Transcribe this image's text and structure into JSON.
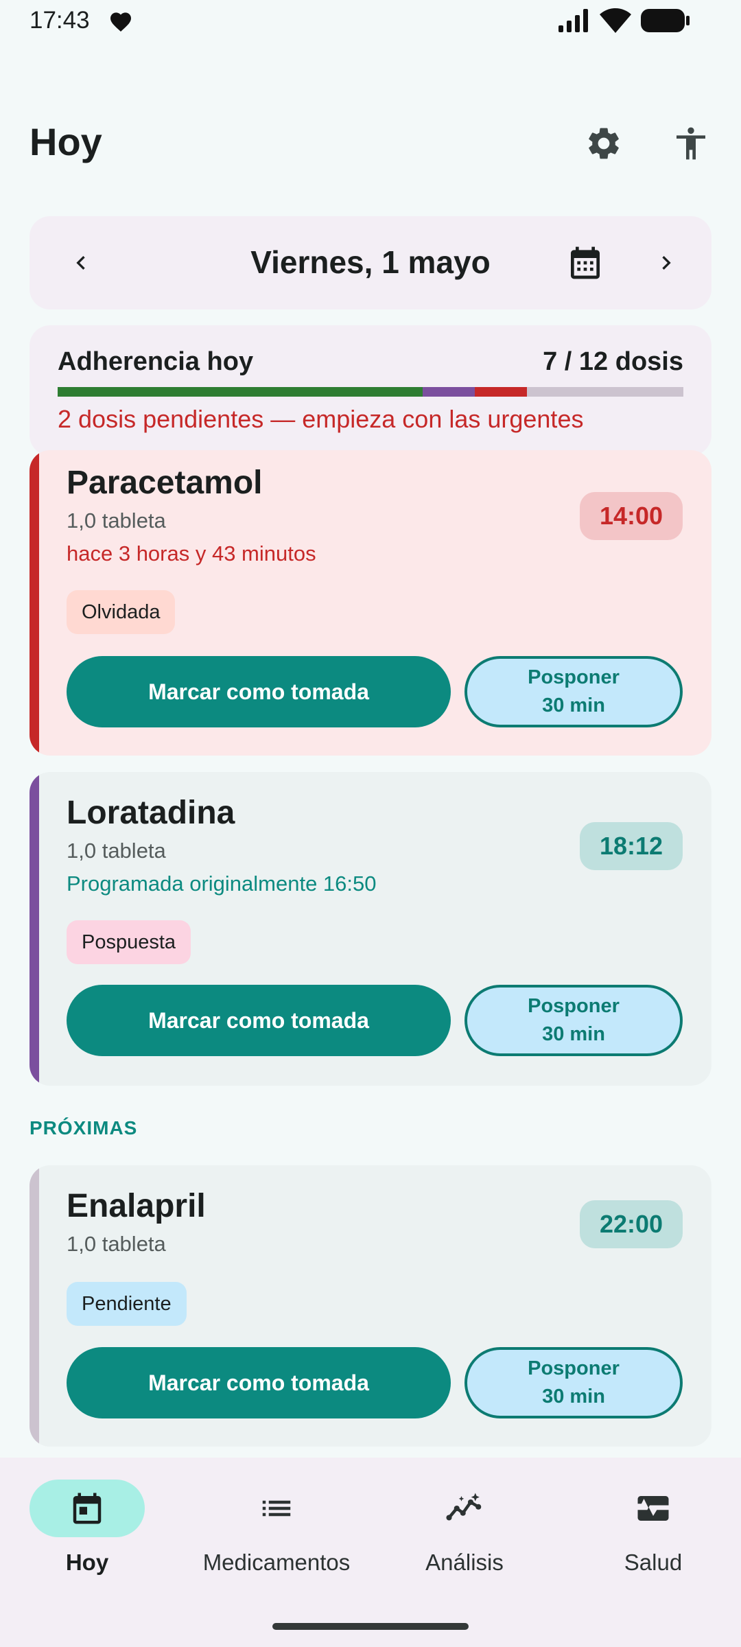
{
  "status_bar": {
    "time": "17:43"
  },
  "header": {
    "title": "Hoy"
  },
  "date_nav": {
    "label": "Viernes, 1 mayo"
  },
  "adherence": {
    "title": "Adherencia hoy",
    "count": "7 / 12 dosis",
    "taken": 7,
    "postponed": 1,
    "missed": 1,
    "total": 12,
    "warning": "2 dosis pendientes — empieza con las urgentes"
  },
  "doses": [
    {
      "name": "Paracetamol",
      "qty": "1,0 tableta",
      "note": "hace 3 horas y 43 minutos",
      "time": "14:00",
      "status": "Olvidada",
      "take_label": "Marcar como tomada",
      "postpone_line1": "Posponer",
      "postpone_line2": "30 min"
    },
    {
      "name": "Loratadina",
      "qty": "1,0 tableta",
      "note": "Programada originalmente 16:50",
      "time": "18:12",
      "status": "Pospuesta",
      "take_label": "Marcar como tomada",
      "postpone_line1": "Posponer",
      "postpone_line2": "30 min"
    },
    {
      "name": "Enalapril",
      "qty": "1,0 tableta",
      "time": "22:00",
      "status": "Pendiente",
      "take_label": "Marcar como tomada",
      "postpone_line1": "Posponer",
      "postpone_line2": "30 min"
    }
  ],
  "section": {
    "upcoming": "PRÓXIMAS"
  },
  "bottom_nav": {
    "items": [
      {
        "label": "Hoy",
        "icon": "calendar-today-icon",
        "active": true
      },
      {
        "label": "Medicamentos",
        "icon": "list-icon"
      },
      {
        "label": "Análisis",
        "icon": "insights-icon"
      },
      {
        "label": "Salud",
        "icon": "monitor-heart-icon"
      }
    ]
  },
  "colors": {
    "accent": "#0C8A80",
    "missed": "#C62828",
    "postponed": "#7B4F9E",
    "taken": "#2E7D32",
    "pending": "#CCC3CF"
  }
}
